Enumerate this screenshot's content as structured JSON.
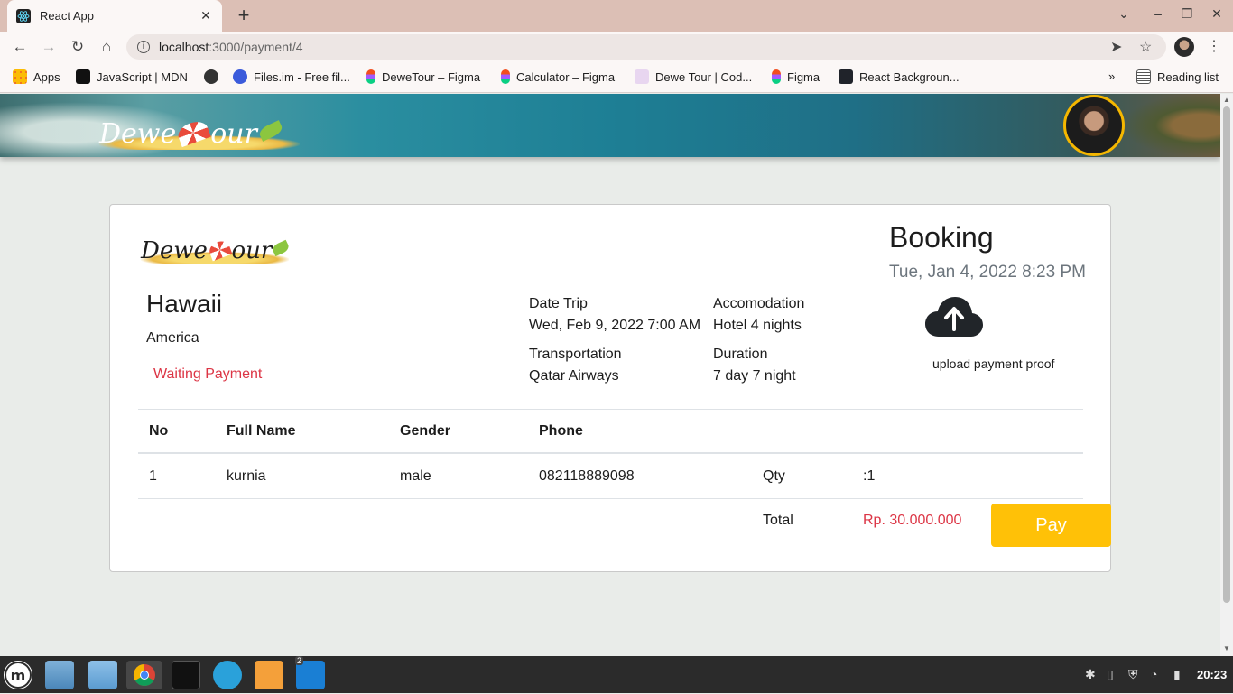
{
  "browser": {
    "tab_title": "React App",
    "url_host": "localhost",
    "url_path": ":3000/payment/4",
    "bookmarks": [
      {
        "label": "Apps",
        "color": "#4285f4"
      },
      {
        "label": "JavaScript | MDN",
        "color": "#111111"
      },
      {
        "label": "",
        "color": "#333333"
      },
      {
        "label": "Files.im - Free fil...",
        "color": "#3b5bdb"
      },
      {
        "label": "DeweTour – Figma",
        "color": "#f24e1e"
      },
      {
        "label": "Calculator – Figma",
        "color": "#f24e1e"
      },
      {
        "label": "Dewe Tour | Cod...",
        "color": "#9b59b6"
      },
      {
        "label": "Figma",
        "color": "#f24e1e"
      },
      {
        "label": "React Backgroun...",
        "color": "#20232a"
      }
    ],
    "overflow_label": "»",
    "reading_list": "Reading list"
  },
  "header": {
    "logo_text_a": "Dewe",
    "logo_text_b": "our"
  },
  "booking": {
    "title": "Booking",
    "date": "Tue, Jan 4, 2022 8:23 PM",
    "destination": "Hawaii",
    "country": "America",
    "status": "Waiting Payment",
    "date_trip_label": "Date Trip",
    "date_trip_value": "Wed, Feb 9, 2022 7:00 AM",
    "accommodation_label": "Accomodation",
    "accommodation_value": "Hotel 4 nights",
    "transportation_label": "Transportation",
    "transportation_value": "Qatar Airways",
    "duration_label": "Duration",
    "duration_value": "7 day 7 night",
    "upload_label": "upload payment proof"
  },
  "table": {
    "headers": [
      "No",
      "Full Name",
      "Gender",
      "Phone"
    ],
    "rows": [
      {
        "no": "1",
        "name": "kurnia",
        "gender": "male",
        "phone": "082118889098",
        "qty_label": "Qty",
        "qty_value": ":1"
      }
    ],
    "total_label": "Total",
    "total_value": "Rp. 30.000.000"
  },
  "actions": {
    "pay_label": "Pay"
  },
  "taskbar": {
    "clock": "20:23",
    "vscode_badge": "2"
  },
  "colors": {
    "accent_yellow": "#ffc107",
    "status_red": "#dc3545"
  }
}
